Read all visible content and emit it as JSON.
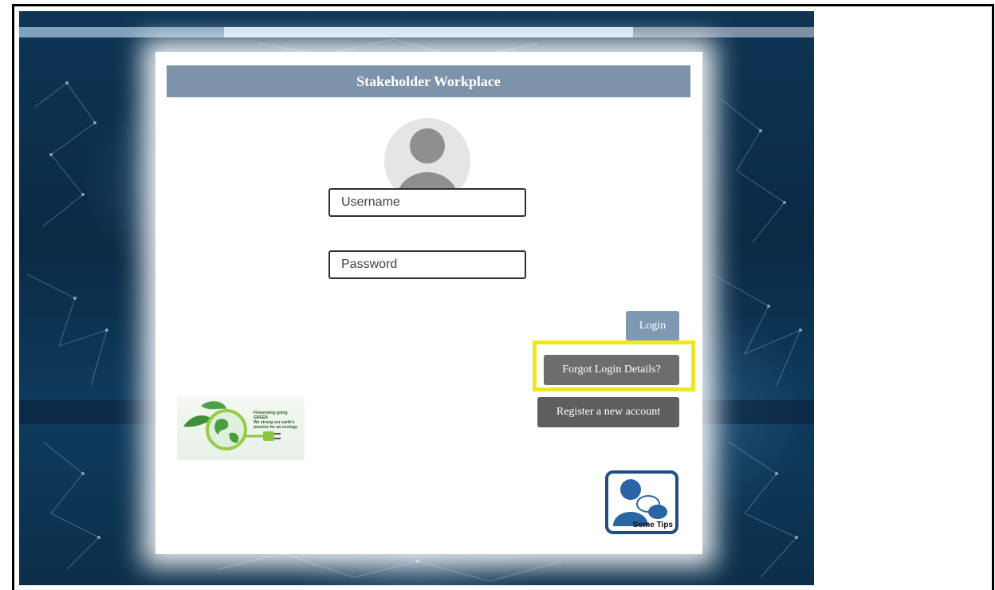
{
  "header": {
    "title": "Stakeholder Workplace"
  },
  "form": {
    "username_placeholder": "Username",
    "username_value": "",
    "password_placeholder": "Password",
    "password_value": ""
  },
  "buttons": {
    "login": "Login",
    "forgot": "Forgot Login Details?",
    "register": "Register a new account"
  },
  "tips": {
    "label": "Some Tips"
  },
  "logo": {
    "line1": "Flowerwing going",
    "line2": "GREEN",
    "line3": "We strong our earth's",
    "line4": "practice for an ecology"
  },
  "icons": {
    "avatar": "user-avatar-icon",
    "logo": "green-earth-plug-logo",
    "tips": "user-chat-icon"
  },
  "colors": {
    "header_bg": "#7d93aa",
    "login_btn": "#7e9ab3",
    "forgot_btn": "#6d6d6d",
    "register_btn": "#5e5e5e",
    "highlight": "#f0e81c",
    "tips_border": "#1c4f86"
  }
}
